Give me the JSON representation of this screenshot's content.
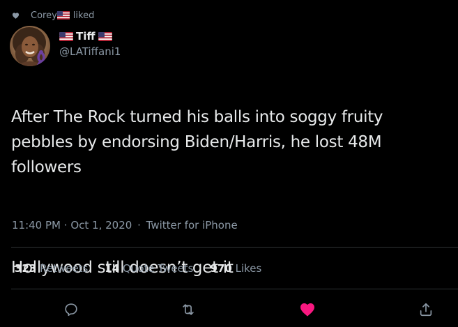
{
  "social_context": {
    "user": "Corey",
    "flag_icon": "us-flag-icon",
    "action": "liked"
  },
  "author": {
    "display_name": "Tiff",
    "handle": "@LATiffani1",
    "avatar_icon": "profile-photo-avatar"
  },
  "tweet": {
    "paragraph_1": "After The Rock turned his balls into soggy fruity pebbles by endorsing Biden/Harris, he lost 48M followers",
    "paragraph_2": "Hollywood still doesn’t get it"
  },
  "meta": {
    "time": "11:40 PM",
    "separator_1": "·",
    "date": "Oct 1, 2020",
    "separator_2": "·",
    "source": "Twitter for iPhone"
  },
  "stats": {
    "retweets_count": "323",
    "retweets_label": "Retweets",
    "quotes_count": "14",
    "quotes_label": "Quote Tweets",
    "likes_count": "970",
    "likes_label": "Likes"
  },
  "actions": {
    "reply_icon": "reply-icon",
    "retweet_icon": "retweet-icon",
    "like_icon": "like-heart-icon",
    "share_icon": "share-icon",
    "liked": true
  },
  "colors": {
    "background": "#000000",
    "text_primary": "#e7e9ea",
    "text_secondary": "#8b98a5",
    "divider": "#2f3336",
    "like_active": "#f91880",
    "awareness_ribbon": "#6b3fa0"
  }
}
